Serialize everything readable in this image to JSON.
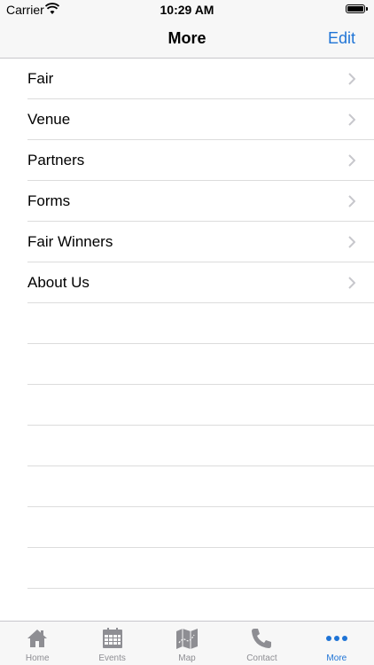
{
  "status_bar": {
    "carrier": "Carrier",
    "time": "10:29 AM"
  },
  "nav": {
    "title": "More",
    "edit_label": "Edit"
  },
  "list": {
    "items": [
      {
        "label": "Fair"
      },
      {
        "label": "Venue"
      },
      {
        "label": "Partners"
      },
      {
        "label": "Forms"
      },
      {
        "label": "Fair Winners"
      },
      {
        "label": "About Us"
      }
    ]
  },
  "tab_bar": {
    "tabs": [
      {
        "label": "Home",
        "icon": "home-icon"
      },
      {
        "label": "Events",
        "icon": "calendar-icon"
      },
      {
        "label": "Map",
        "icon": "map-icon"
      },
      {
        "label": "Contact",
        "icon": "phone-icon"
      },
      {
        "label": "More",
        "icon": "more-icon"
      }
    ],
    "active": "More"
  },
  "colors": {
    "accent": "#1f74d6",
    "inactive": "#8e8e93",
    "bar_bg": "#f7f7f7"
  }
}
